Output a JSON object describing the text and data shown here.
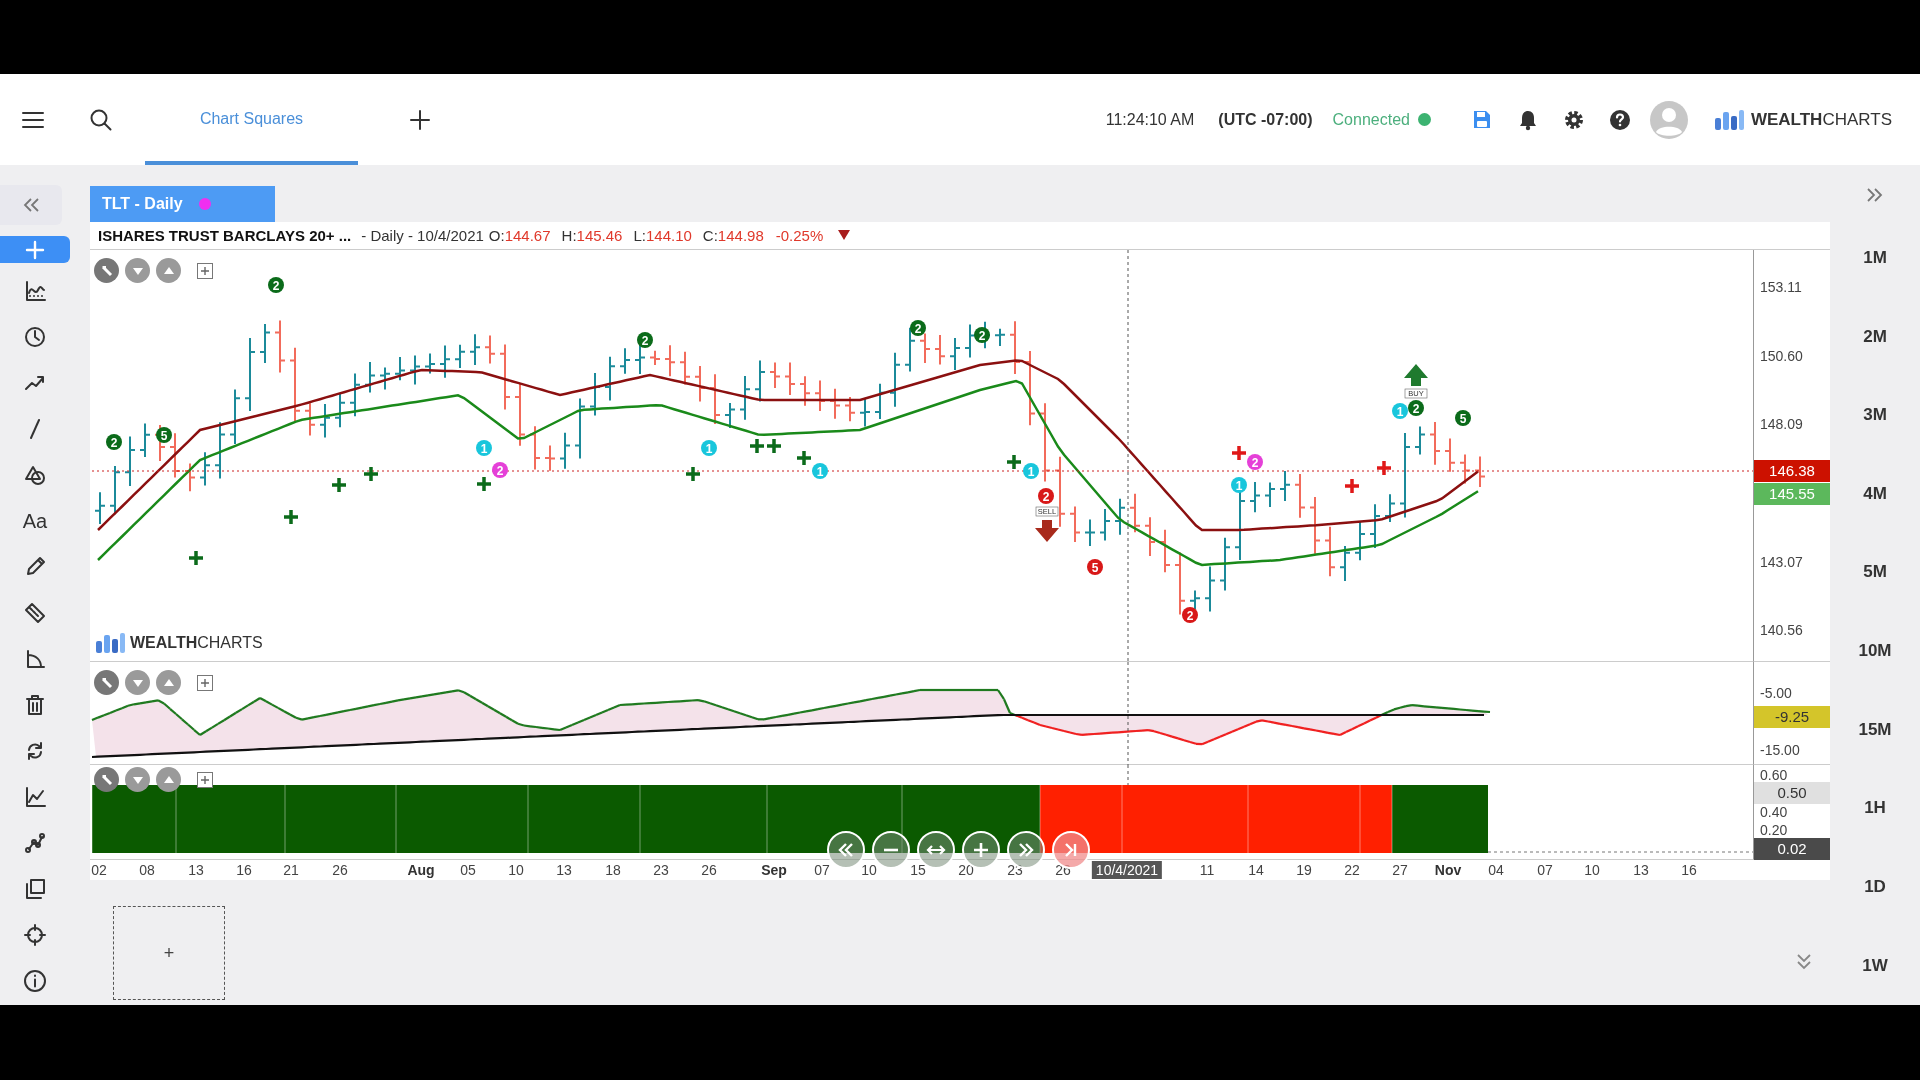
{
  "header": {
    "tabs": [
      {
        "label": "Chart Squares",
        "selected": true
      }
    ],
    "clock": "11:24:10 AM",
    "timezone": "(UTC -07:00)",
    "connection": {
      "label": "Connected",
      "connected": true
    },
    "logo": "**WEALTH**CHARTS"
  },
  "tools": [
    {
      "kind": "crosshair",
      "selected": true
    },
    {
      "kind": "indicators",
      "selected": false
    },
    {
      "kind": "clock",
      "selected": false
    },
    {
      "kind": "trend",
      "selected": false
    },
    {
      "kind": "line",
      "selected": false
    },
    {
      "kind": "shapes",
      "selected": false
    },
    {
      "kind": "text",
      "label": "Aa",
      "selected": false
    },
    {
      "kind": "pencil",
      "selected": false
    },
    {
      "kind": "ruler",
      "selected": false
    },
    {
      "kind": "angle",
      "selected": false
    },
    {
      "kind": "trash",
      "selected": false
    },
    {
      "kind": "refresh",
      "selected": false
    },
    {
      "kind": "linechart",
      "selected": false
    },
    {
      "kind": "nodes",
      "selected": false
    },
    {
      "kind": "layers",
      "selected": false
    },
    {
      "kind": "target",
      "selected": false
    },
    {
      "kind": "info",
      "selected": false
    }
  ],
  "chart": {
    "tab": "TLT - Daily",
    "legend": {
      "symbol": "ISHARES TRUST BARCLAYS 20+ ...",
      "interval": "- Daily - 10/4/2021",
      "values": [
        {
          "label": "O:",
          "value": "144.67"
        },
        {
          "label": "H:",
          "value": "145.46"
        },
        {
          "label": "L:",
          "value": "144.10"
        },
        {
          "label": "C:",
          "value": "144.98"
        }
      ],
      "change": "-0.25%",
      "down": true
    },
    "logo": "**WEALTH**CHARTS",
    "signals": [
      {
        "kind": "badge",
        "label": "2",
        "color": "#0b6b1a"
      },
      {
        "kind": "badge",
        "label": "2",
        "color": "#0b6b1a"
      },
      {
        "kind": "badge",
        "label": "2",
        "color": "#0b6b1a"
      },
      {
        "kind": "badge",
        "label": "2",
        "color": "#0b6b1a"
      },
      {
        "kind": "badge",
        "label": "2",
        "color": "#0b6b1a"
      },
      {
        "kind": "badge",
        "label": "2",
        "color": "#0b6b1a"
      },
      {
        "kind": "badge",
        "label": "5",
        "color": "#0b6b1a"
      },
      {
        "kind": "badge",
        "label": "5",
        "color": "#0b6b1a"
      },
      {
        "kind": "badge",
        "label": "1",
        "color": "#19c6dc"
      },
      {
        "kind": "badge",
        "label": "1",
        "color": "#19c6dc"
      },
      {
        "kind": "badge",
        "label": "1",
        "color": "#19c6dc"
      },
      {
        "kind": "badge",
        "label": "1",
        "color": "#19c6dc"
      },
      {
        "kind": "badge",
        "label": "1",
        "color": "#19c6dc"
      },
      {
        "kind": "badge",
        "label": "1",
        "color": "#19c6dc"
      },
      {
        "kind": "badge",
        "label": "2",
        "color": "#e540d8"
      },
      {
        "kind": "badge",
        "label": "2",
        "color": "#e540d8"
      },
      {
        "kind": "badge",
        "label": "2",
        "color": "#d81818"
      },
      {
        "kind": "badge",
        "label": "2",
        "color": "#d81818"
      },
      {
        "kind": "badge",
        "label": "5",
        "color": "#d81818"
      },
      {
        "kind": "arrow",
        "label": "BUY",
        "up": true,
        "color": "#1f7a2e"
      },
      {
        "kind": "arrow",
        "label": "SELL",
        "up": false,
        "color": "#a82a1c"
      }
    ],
    "price_axis": [
      {
        "kind": "tick",
        "text": "153.11"
      },
      {
        "kind": "tick",
        "text": "150.60"
      },
      {
        "kind": "tick",
        "text": "148.09"
      },
      {
        "kind": "badge",
        "text": "146.38",
        "color": "#cc1100"
      },
      {
        "kind": "badge",
        "text": "145.55",
        "color": "#5cb85c"
      },
      {
        "kind": "tick",
        "text": "143.07"
      },
      {
        "kind": "tick",
        "text": "140.56"
      }
    ],
    "oscillator_axis": [
      {
        "kind": "tick",
        "text": "-5.00"
      },
      {
        "kind": "badge",
        "text": "-9.25",
        "color": "#d4c52a"
      },
      {
        "kind": "tick",
        "text": "-15.00"
      }
    ],
    "histogram_axis": [
      {
        "kind": "tick",
        "text": "0.60"
      },
      {
        "kind": "badge",
        "text": "0.50",
        "color": "#e0e0e0"
      },
      {
        "kind": "tick",
        "text": "0.40"
      },
      {
        "kind": "tick",
        "text": "0.20"
      },
      {
        "kind": "badge",
        "text": "0.02",
        "color": "#4a4a4a"
      }
    ],
    "x_axis": [
      {
        "kind": "day",
        "text": "02"
      },
      {
        "kind": "day",
        "text": "08"
      },
      {
        "kind": "day",
        "text": "13"
      },
      {
        "kind": "day",
        "text": "16"
      },
      {
        "kind": "day",
        "text": "21"
      },
      {
        "kind": "day",
        "text": "26"
      },
      {
        "kind": "month",
        "text": "Aug"
      },
      {
        "kind": "day",
        "text": "05"
      },
      {
        "kind": "day",
        "text": "10"
      },
      {
        "kind": "day",
        "text": "13"
      },
      {
        "kind": "day",
        "text": "18"
      },
      {
        "kind": "day",
        "text": "23"
      },
      {
        "kind": "day",
        "text": "26"
      },
      {
        "kind": "month",
        "text": "Sep"
      },
      {
        "kind": "day",
        "text": "07"
      },
      {
        "kind": "day",
        "text": "10"
      },
      {
        "kind": "day",
        "text": "15"
      },
      {
        "kind": "day",
        "text": "20"
      },
      {
        "kind": "day",
        "text": "23"
      },
      {
        "kind": "day",
        "text": "26"
      },
      {
        "kind": "cursor",
        "text": "10/4/2021"
      },
      {
        "kind": "day",
        "text": "11"
      },
      {
        "kind": "day",
        "text": "14"
      },
      {
        "kind": "day",
        "text": "19"
      },
      {
        "kind": "day",
        "text": "22"
      },
      {
        "kind": "day",
        "text": "27"
      },
      {
        "kind": "month",
        "text": "Nov"
      },
      {
        "kind": "day",
        "text": "04"
      },
      {
        "kind": "day",
        "text": "07"
      },
      {
        "kind": "day",
        "text": "10"
      },
      {
        "kind": "day",
        "text": "13"
      },
      {
        "kind": "day",
        "text": "16"
      }
    ]
  },
  "add_chart": "+",
  "timeframes": [
    "1M",
    "2M",
    "3M",
    "4M",
    "5M",
    "10M",
    "15M",
    "1H",
    "1D",
    "1W"
  ]
}
